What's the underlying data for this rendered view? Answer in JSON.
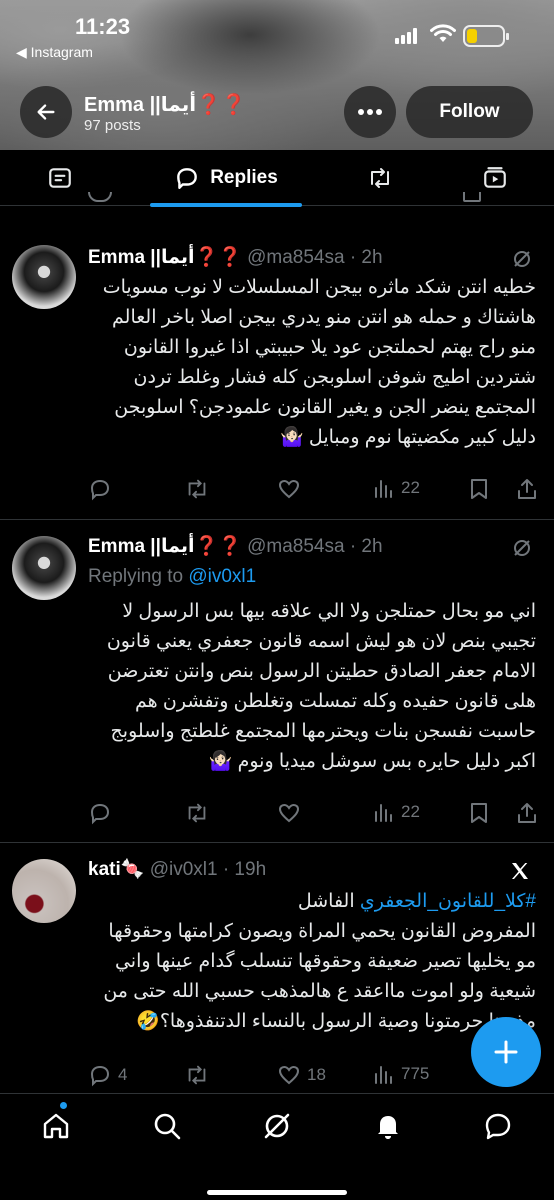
{
  "status_bar": {
    "time": "11:23",
    "back_to_app": "◀ Instagram"
  },
  "header": {
    "profile_name": "Emma ||أيما❓❓",
    "posts_count": "97 posts",
    "follow_label": "Follow"
  },
  "tabs": {
    "active_label": "Replies"
  },
  "tweets": [
    {
      "author": "Emma ||أيما❓❓",
      "handle_time": "@ma854sa · 2h",
      "text": "خطيه انتن شكد ماثره بيجن المسلسلات لا نوب مسويات هاشتاك و حمله هو انتن منو يدري بيجن اصلا باخر العالم منو راح يهتم لحملتجن عود يلا حبيبتي اذا غيروا القانون شتردين اطيج شوفن اسلوبجن كله فشار وغلط تردن المجتمع ينضر الجن و يغير القانون علمودجن؟ اسلوبجن دليل كبير مكضيتها نوم ومبايل 🤷🏻‍♀️",
      "views": "22"
    },
    {
      "author": "Emma ||أيما❓❓",
      "handle_time": "@ma854sa · 2h",
      "replying_prefix": "Replying to",
      "replying_handle": "@iv0xl1",
      "text": "اني مو بحال حمتلجن ولا الي علاقه بيها بس الرسول لا تجيبي بنص لان هو ليش اسمه قانون جعفري يعني قانون الامام جعفر الصادق حطيتن الرسول بنص وانتن تعترضن هلى قانون حفيده وكله تمسلت وتغلطن وتفشرن هم حاسبت نفسجن بنات ويحترمها المجتمع غلطتج واسلوبج اكبر دليل حايره بس سوشل ميديا ونوم 🤷🏻‍♀️",
      "views": "22"
    },
    {
      "author": "kati🍬",
      "handle_time": "@iv0xl1 · 19h",
      "hashtag": "#كلا_للقانون_الجعفري",
      "text_after_hashtag": " الفاشل",
      "text": "المفروض القانون يحمي المراة ويصون كرامتها وحقوقها مو يخليها تصير ضعيفة وحقوقها تنسلب گدام عينها واني شيعية ولو اموت مااعقد ع هالمذهب حسبي الله حتى من مذهبنا حرمتونا وصية الرسول بالنساء الدتنفذوها؟🤣",
      "replies": "4",
      "likes": "18",
      "views": "775"
    }
  ],
  "colors": {
    "accent": "#1d9bf0",
    "muted": "#71767b",
    "divider": "#2f3336"
  },
  "icons": {
    "bottom_nav": [
      "home-icon",
      "search-icon",
      "grok-icon",
      "notifications-icon",
      "messages-icon"
    ],
    "tabs": [
      "posts-icon",
      "replies-icon",
      "reposts-icon",
      "media-icon"
    ]
  }
}
